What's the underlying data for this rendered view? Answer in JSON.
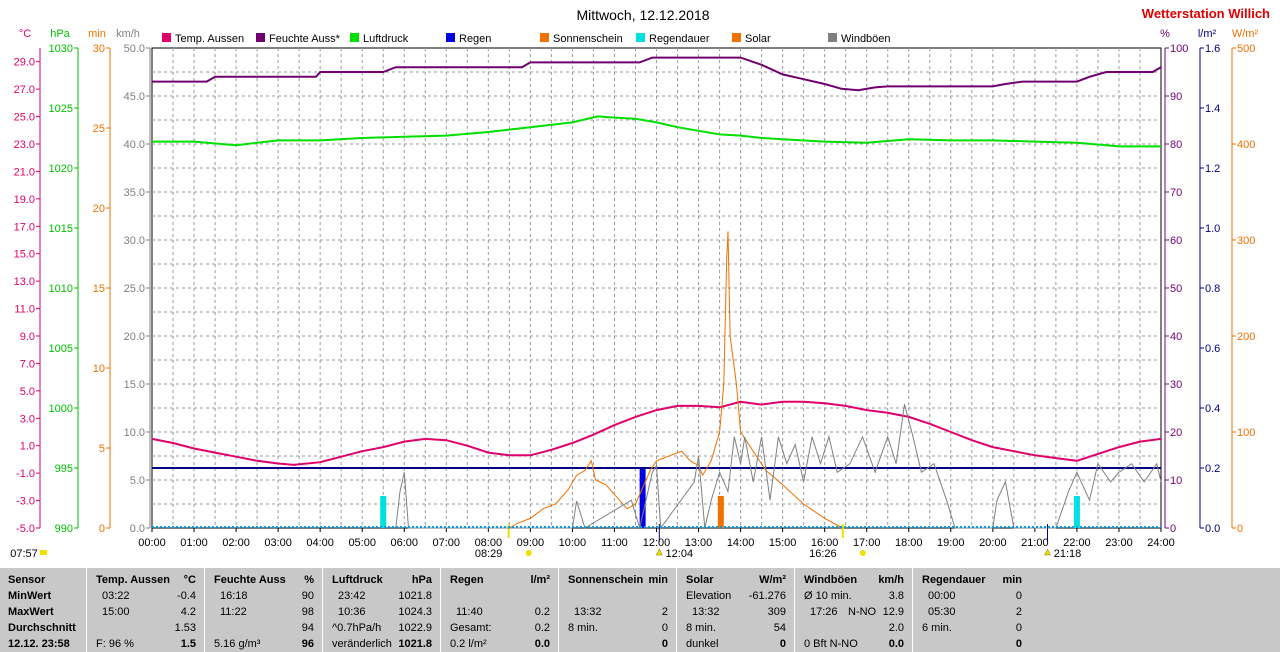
{
  "header": {
    "title": "Mittwoch, 12.12.2018",
    "station": "Wetterstation Willich",
    "station_color": "#e00000"
  },
  "legend": [
    {
      "label": "Temp. Aussen",
      "color": "#e0006c"
    },
    {
      "label": "Feuchte Auss*",
      "color": "#700070"
    },
    {
      "label": "Luftdruck",
      "color": "#00e000"
    },
    {
      "label": "Regen",
      "color": "#0000e0"
    },
    {
      "label": "Sonnenschein",
      "color": "#f07000"
    },
    {
      "label": "Regendauer",
      "color": "#00e0e0"
    },
    {
      "label": "Solar",
      "color": "#f07000"
    },
    {
      "label": "Windböen",
      "color": "#808080"
    }
  ],
  "axes_left": [
    {
      "unit": "°C",
      "color": "#e0006c",
      "ticks": [
        "29.0",
        "27.0",
        "25.0",
        "23.0",
        "21.0",
        "19.0",
        "17.0",
        "15.0",
        "13.0",
        "11.0",
        "9.0",
        "7.0",
        "5.0",
        "3.0",
        "1.0",
        "-1.0",
        "-3.0",
        "-5.0"
      ]
    },
    {
      "unit": "hPa",
      "color": "#00c000",
      "ticks": [
        "1030",
        "1025",
        "1020",
        "1015",
        "1010",
        "1005",
        "1000",
        "995",
        "990"
      ]
    },
    {
      "unit": "min",
      "color": "#f07000",
      "ticks": [
        "30",
        "25",
        "20",
        "15",
        "10",
        "5",
        "0"
      ]
    },
    {
      "unit": "km/h",
      "color": "#808080",
      "ticks": [
        "50.0",
        "45.0",
        "40.0",
        "35.0",
        "30.0",
        "25.0",
        "20.0",
        "15.0",
        "10.0",
        "5.0",
        "0.0"
      ]
    }
  ],
  "axes_right": [
    {
      "unit": "%",
      "color": "#700070",
      "ticks": [
        "100",
        "90",
        "80",
        "70",
        "60",
        "50",
        "40",
        "30",
        "20",
        "10",
        "0"
      ]
    },
    {
      "unit": "l/m²",
      "color": "#000080",
      "ticks": [
        "1.6",
        "1.4",
        "1.2",
        "1.0",
        "0.8",
        "0.6",
        "0.4",
        "0.2",
        "0.0"
      ]
    },
    {
      "unit": "W/m²",
      "color": "#f07000",
      "ticks": [
        "500",
        "400",
        "300",
        "200",
        "100",
        "0"
      ]
    }
  ],
  "time_axis": {
    "labels": [
      "00:00",
      "01:00",
      "02:00",
      "03:00",
      "04:00",
      "05:00",
      "06:00",
      "07:00",
      "08:00",
      "09:00",
      "10:00",
      "11:00",
      "12:00",
      "13:00",
      "14:00",
      "15:00",
      "16:00",
      "17:00",
      "18:00",
      "19:00",
      "20:00",
      "21:00",
      "22:00",
      "23:00",
      "24:00"
    ],
    "sunrise": "08:29",
    "sunset": "16:26",
    "moonrise": "12:04",
    "moonset": "21:18",
    "daylight_start": "07:57"
  },
  "chart_data": {
    "type": "line",
    "x_label": "Uhrzeit",
    "x_range_hours": [
      0,
      24
    ],
    "series": [
      {
        "name": "Temp. Aussen",
        "unit": "°C",
        "axis_range": [
          -5,
          30
        ],
        "color": "#e0006c",
        "points": [
          [
            0,
            1.5
          ],
          [
            0.5,
            1.2
          ],
          [
            1,
            0.8
          ],
          [
            1.5,
            0.5
          ],
          [
            2,
            0.2
          ],
          [
            2.5,
            -0.1
          ],
          [
            3,
            -0.3
          ],
          [
            3.37,
            -0.4
          ],
          [
            4,
            -0.2
          ],
          [
            4.5,
            0.2
          ],
          [
            5,
            0.6
          ],
          [
            5.5,
            0.9
          ],
          [
            6,
            1.3
          ],
          [
            6.5,
            1.5
          ],
          [
            7,
            1.4
          ],
          [
            7.5,
            1.0
          ],
          [
            8,
            0.5
          ],
          [
            8.5,
            0.3
          ],
          [
            9,
            0.3
          ],
          [
            9.5,
            0.7
          ],
          [
            10,
            1.2
          ],
          [
            10.5,
            1.8
          ],
          [
            11,
            2.5
          ],
          [
            11.5,
            3.1
          ],
          [
            12,
            3.6
          ],
          [
            12.5,
            3.9
          ],
          [
            13,
            3.9
          ],
          [
            13.5,
            3.8
          ],
          [
            14,
            4.2
          ],
          [
            14.5,
            4.0
          ],
          [
            15,
            4.2
          ],
          [
            15.5,
            4.2
          ],
          [
            16,
            4.1
          ],
          [
            16.5,
            3.9
          ],
          [
            17,
            3.6
          ],
          [
            17.5,
            3.4
          ],
          [
            18,
            3.1
          ],
          [
            18.5,
            2.6
          ],
          [
            19,
            2.0
          ],
          [
            19.5,
            1.4
          ],
          [
            20,
            0.9
          ],
          [
            20.5,
            0.6
          ],
          [
            21,
            0.3
          ],
          [
            21.5,
            0.1
          ],
          [
            22,
            -0.1
          ],
          [
            22.5,
            0.4
          ],
          [
            23,
            0.9
          ],
          [
            23.5,
            1.3
          ],
          [
            24,
            1.5
          ]
        ]
      },
      {
        "name": "Feuchte Auss*",
        "unit": "%",
        "axis_range": [
          0,
          100
        ],
        "color": "#700070",
        "points": [
          [
            0,
            93
          ],
          [
            1.3,
            93
          ],
          [
            1.5,
            94
          ],
          [
            3.9,
            94
          ],
          [
            4,
            95
          ],
          [
            5.5,
            95
          ],
          [
            5.8,
            96
          ],
          [
            8.8,
            96
          ],
          [
            9,
            97
          ],
          [
            11.6,
            97
          ],
          [
            11.9,
            98
          ],
          [
            14.0,
            98
          ],
          [
            14.5,
            96.5
          ],
          [
            15,
            94.5
          ],
          [
            15.5,
            93.5
          ],
          [
            16,
            92.5
          ],
          [
            16.4,
            91.5
          ],
          [
            16.8,
            91.2
          ],
          [
            17.2,
            91.8
          ],
          [
            17.5,
            92
          ],
          [
            20.0,
            92
          ],
          [
            20.3,
            92.5
          ],
          [
            20.7,
            93
          ],
          [
            22.0,
            93
          ],
          [
            22.3,
            94
          ],
          [
            22.7,
            95
          ],
          [
            23.8,
            95
          ],
          [
            24,
            96
          ]
        ]
      },
      {
        "name": "Luftdruck",
        "unit": "hPa",
        "axis_range": [
          990,
          1030
        ],
        "color": "#00e000",
        "points": [
          [
            0,
            1022.2
          ],
          [
            1,
            1022.2
          ],
          [
            2,
            1021.9
          ],
          [
            3,
            1022.3
          ],
          [
            4,
            1022.3
          ],
          [
            5,
            1022.5
          ],
          [
            6,
            1022.6
          ],
          [
            7,
            1022.7
          ],
          [
            8,
            1023.0
          ],
          [
            9,
            1023.4
          ],
          [
            10,
            1023.8
          ],
          [
            10.6,
            1024.3
          ],
          [
            11,
            1024.2
          ],
          [
            11.5,
            1024.1
          ],
          [
            12,
            1023.8
          ],
          [
            12.5,
            1023.4
          ],
          [
            13,
            1023.1
          ],
          [
            13.5,
            1022.8
          ],
          [
            14,
            1022.7
          ],
          [
            14.5,
            1022.5
          ],
          [
            15,
            1022.4
          ],
          [
            16,
            1022.2
          ],
          [
            17,
            1022.1
          ],
          [
            18,
            1022.4
          ],
          [
            19,
            1022.3
          ],
          [
            20,
            1022.3
          ],
          [
            21,
            1022.2
          ],
          [
            22,
            1022.1
          ],
          [
            23,
            1021.8
          ],
          [
            24,
            1021.8
          ]
        ]
      },
      {
        "name": "Regen",
        "unit": "l/m²",
        "axis_range": [
          0,
          1.6
        ],
        "color": "#0000e0",
        "bars": [
          [
            11.67,
            0.2
          ]
        ],
        "level": 0.2
      },
      {
        "name": "Sonnenschein",
        "unit": "min",
        "axis_range": [
          0,
          30
        ],
        "color": "#f07000",
        "bars": [
          [
            13.53,
            2
          ]
        ]
      },
      {
        "name": "Regendauer",
        "unit": "min",
        "axis_range": [
          0,
          30
        ],
        "color": "#00e0e0",
        "bars": [
          [
            5.5,
            2
          ],
          [
            22.0,
            2
          ]
        ]
      },
      {
        "name": "Solar",
        "unit": "W/m²",
        "axis_range": [
          0,
          500
        ],
        "color": "#f07000",
        "points": [
          [
            8.5,
            0
          ],
          [
            8.7,
            5
          ],
          [
            9,
            10
          ],
          [
            9.3,
            20
          ],
          [
            9.6,
            25
          ],
          [
            9.9,
            40
          ],
          [
            10.1,
            55
          ],
          [
            10.3,
            60
          ],
          [
            10.45,
            70
          ],
          [
            10.55,
            50
          ],
          [
            10.8,
            45
          ],
          [
            11,
            35
          ],
          [
            11.3,
            20
          ],
          [
            11.5,
            25
          ],
          [
            11.7,
            45
          ],
          [
            11.85,
            60
          ],
          [
            12,
            70
          ],
          [
            12.3,
            75
          ],
          [
            12.6,
            80
          ],
          [
            12.8,
            70
          ],
          [
            13,
            65
          ],
          [
            13.1,
            55
          ],
          [
            13.3,
            70
          ],
          [
            13.5,
            100
          ],
          [
            13.6,
            150
          ],
          [
            13.67,
            280
          ],
          [
            13.7,
            309
          ],
          [
            13.75,
            200
          ],
          [
            13.9,
            150
          ],
          [
            14,
            100
          ],
          [
            14.3,
            80
          ],
          [
            14.6,
            60
          ],
          [
            15,
            45
          ],
          [
            15.5,
            25
          ],
          [
            16,
            10
          ],
          [
            16.43,
            0
          ]
        ]
      },
      {
        "name": "Windböen",
        "unit": "km/h",
        "axis_range": [
          0,
          50
        ],
        "color": "#808080",
        "points": [
          [
            5.8,
            0
          ],
          [
            5.9,
            3.8
          ],
          [
            6,
            5.8
          ],
          [
            6.1,
            0
          ],
          [
            10,
            0
          ],
          [
            10.1,
            2.8
          ],
          [
            10.3,
            0
          ],
          [
            11.4,
            2.9
          ],
          [
            11.6,
            0
          ],
          [
            11.9,
            5.8
          ],
          [
            12,
            6.5
          ],
          [
            12.1,
            0
          ],
          [
            12.9,
            4.8
          ],
          [
            13,
            7.5
          ],
          [
            13.15,
            0
          ],
          [
            13.3,
            2.9
          ],
          [
            13.5,
            5.8
          ],
          [
            13.7,
            3.8
          ],
          [
            13.85,
            9.5
          ],
          [
            14,
            6.7
          ],
          [
            14.1,
            9.5
          ],
          [
            14.3,
            4.8
          ],
          [
            14.5,
            9.5
          ],
          [
            14.7,
            2.9
          ],
          [
            14.9,
            9.5
          ],
          [
            15.1,
            6.7
          ],
          [
            15.3,
            8.7
          ],
          [
            15.5,
            4.8
          ],
          [
            15.7,
            9.5
          ],
          [
            15.9,
            6.7
          ],
          [
            16.1,
            9.5
          ],
          [
            16.3,
            5.8
          ],
          [
            16.6,
            6.7
          ],
          [
            16.9,
            9.5
          ],
          [
            17.2,
            5.8
          ],
          [
            17.5,
            9.5
          ],
          [
            17.7,
            6.7
          ],
          [
            17.9,
            12.9
          ],
          [
            18.1,
            9.5
          ],
          [
            18.3,
            5.8
          ],
          [
            18.6,
            6.7
          ],
          [
            18.9,
            2.9
          ],
          [
            19.1,
            0
          ],
          [
            20,
            0
          ],
          [
            20.1,
            2.9
          ],
          [
            20.3,
            4.8
          ],
          [
            20.5,
            0
          ],
          [
            21.5,
            0
          ],
          [
            21.8,
            3.8
          ],
          [
            22,
            5.8
          ],
          [
            22.3,
            2.9
          ],
          [
            22.5,
            6.7
          ],
          [
            22.8,
            4.8
          ],
          [
            23,
            5.8
          ],
          [
            23.3,
            6.7
          ],
          [
            23.6,
            4.8
          ],
          [
            23.9,
            6.7
          ],
          [
            24,
            4.8
          ]
        ]
      }
    ]
  },
  "stats": {
    "sensor": {
      "title": "Sensor",
      "rows": [
        "MinWert",
        "MaxWert",
        "Durchschnitt"
      ],
      "footer": "12.12. 23:58"
    },
    "temp": {
      "title": "Temp. Aussen",
      "unit": "°C",
      "min_time": "03:22",
      "min_val": "-0.4",
      "max_time": "15:00",
      "max_val": "4.2",
      "avg": "1.53",
      "footer_left": "F: 96 %",
      "footer_val": "1.5"
    },
    "humidity": {
      "title": "Feuchte Auss",
      "unit": "%",
      "min_time": "16:18",
      "min_val": "90",
      "max_time": "11:22",
      "max_val": "98",
      "avg": "94",
      "footer_left": "5.16 g/m³",
      "footer_val": "96"
    },
    "pressure": {
      "title": "Luftdruck",
      "unit": "hPa",
      "min_time": "23:42",
      "min_val": "1021.8",
      "max_time": "10:36",
      "max_val": "1024.3",
      "avg_left": "^0.7hPa/h",
      "avg": "1022.9",
      "footer_left": "veränderlich",
      "footer_val": "1021.8"
    },
    "rain": {
      "title": "Regen",
      "unit": "l/m²",
      "max_time": "11:40",
      "max_val": "0.2",
      "avg_left": "Gesamt:",
      "avg": "0.2",
      "footer_left": "0.2 l/m²",
      "footer_val": "0.0"
    },
    "sunshine": {
      "title": "Sonnenschein",
      "unit": "min",
      "max_time": "13:32",
      "max_val": "2",
      "avg_left": "8 min.",
      "avg": "0",
      "footer_val": "0"
    },
    "solar": {
      "title": "Solar",
      "unit": "W/m²",
      "min_left": "Elevation",
      "min_val": "-61.276",
      "max_time": "13:32",
      "max_val": "309",
      "avg_left": "8 min.",
      "avg": "54",
      "footer_left": "dunkel",
      "footer_val": "0"
    },
    "wind": {
      "title": "Windböen",
      "unit": "km/h",
      "min_left": "Ø 10 min.",
      "min_val": "3.8",
      "max_time": "17:26",
      "max_dir": "N-NO",
      "max_val": "12.9",
      "avg": "2.0",
      "footer_left": "0 Bft N-NO",
      "footer_val": "0.0"
    },
    "rainduration": {
      "title": "Regendauer",
      "unit": "min",
      "min_time": "00:00",
      "min_val": "0",
      "max_time": "05:30",
      "max_val": "2",
      "avg_left": "6 min.",
      "avg": "0",
      "footer_val": "0"
    }
  }
}
